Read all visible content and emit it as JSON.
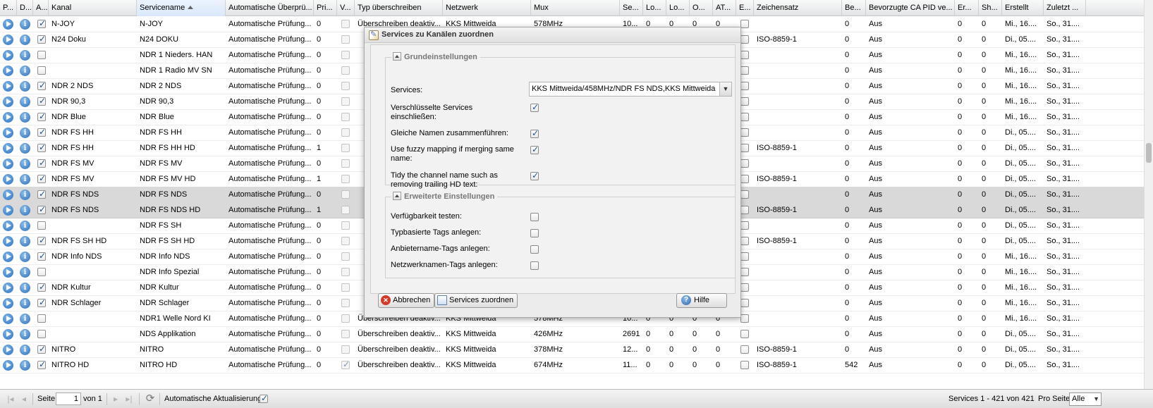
{
  "columns": [
    {
      "label": "P...",
      "w": 24
    },
    {
      "label": "D...",
      "w": 23
    },
    {
      "label": "A...",
      "w": 22
    },
    {
      "label": "Kanal",
      "w": 125
    },
    {
      "label": "Servicename",
      "w": 126,
      "sorted": true
    },
    {
      "label": "Automatische Überprü...",
      "w": 125
    },
    {
      "label": "Pri...",
      "w": 33
    },
    {
      "label": "V...",
      "w": 25
    },
    {
      "label": "Typ überschreiben",
      "w": 125
    },
    {
      "label": "Netzwerk",
      "w": 125
    },
    {
      "label": "Mux",
      "w": 126
    },
    {
      "label": "Se...",
      "w": 33
    },
    {
      "label": "Lo...",
      "w": 33
    },
    {
      "label": "Lo...",
      "w": 33
    },
    {
      "label": "O...",
      "w": 33
    },
    {
      "label": "AT...",
      "w": 33
    },
    {
      "label": "E...",
      "w": 25
    },
    {
      "label": "Zeichensatz",
      "w": 125
    },
    {
      "label": "Be...",
      "w": 34
    },
    {
      "label": "Bevorzugte CA PID ve...",
      "w": 126
    },
    {
      "label": "Er...",
      "w": 34
    },
    {
      "label": "Sh...",
      "w": 33
    },
    {
      "label": "Erstellt",
      "w": 59
    },
    {
      "label": "Zuletzt ...",
      "w": 60
    }
  ],
  "rows": [
    {
      "a": true,
      "kanal": "N-JOY",
      "svc": "N-JOY",
      "auto": "Automatische Prüfung...",
      "pri": "0",
      "v": false,
      "typ": "Überschreiben deaktiv...",
      "net": "KKS Mittweida",
      "mux": "578MHz",
      "se": "10...",
      "lo1": "0",
      "lo2": "0",
      "o": "0",
      "at": "0",
      "zs": "",
      "be": "0",
      "ca": "Aus",
      "er": "0",
      "sh": "0",
      "erst": "Mi., 16....",
      "zul": "So., 31...."
    },
    {
      "a": true,
      "kanal": "N24 Doku",
      "svc": "N24 DOKU",
      "auto": "Automatische Prüfung...",
      "pri": "0",
      "v": false,
      "typ": "",
      "net": "",
      "mux": "",
      "se": "",
      "lo1": "",
      "lo2": "",
      "o": "",
      "at": "",
      "zs": "ISO-8859-1",
      "be": "0",
      "ca": "Aus",
      "er": "0",
      "sh": "0",
      "erst": "Di., 05....",
      "zul": "So., 31...."
    },
    {
      "a": false,
      "kanal": "",
      "svc": "NDR 1 Nieders. HAN",
      "auto": "Automatische Prüfung...",
      "pri": "0",
      "v": false,
      "typ": "",
      "net": "",
      "mux": "",
      "se": "",
      "lo1": "",
      "lo2": "",
      "o": "",
      "at": "",
      "zs": "",
      "be": "0",
      "ca": "Aus",
      "er": "0",
      "sh": "0",
      "erst": "Mi., 16....",
      "zul": "So., 31...."
    },
    {
      "a": false,
      "kanal": "",
      "svc": "NDR 1 Radio MV SN",
      "auto": "Automatische Prüfung...",
      "pri": "0",
      "v": false,
      "typ": "",
      "net": "",
      "mux": "",
      "se": "",
      "lo1": "",
      "lo2": "",
      "o": "",
      "at": "",
      "zs": "",
      "be": "0",
      "ca": "Aus",
      "er": "0",
      "sh": "0",
      "erst": "Mi., 16....",
      "zul": "So., 31...."
    },
    {
      "a": true,
      "kanal": "NDR 2 NDS",
      "svc": "NDR 2 NDS",
      "auto": "Automatische Prüfung...",
      "pri": "0",
      "v": false,
      "typ": "",
      "net": "",
      "mux": "",
      "se": "",
      "lo1": "",
      "lo2": "",
      "o": "",
      "at": "",
      "zs": "",
      "be": "0",
      "ca": "Aus",
      "er": "0",
      "sh": "0",
      "erst": "Mi., 16....",
      "zul": "So., 31...."
    },
    {
      "a": true,
      "kanal": "NDR 90,3",
      "svc": "NDR 90,3",
      "auto": "Automatische Prüfung...",
      "pri": "0",
      "v": false,
      "typ": "",
      "net": "",
      "mux": "",
      "se": "",
      "lo1": "",
      "lo2": "",
      "o": "",
      "at": "",
      "zs": "",
      "be": "0",
      "ca": "Aus",
      "er": "0",
      "sh": "0",
      "erst": "Mi., 16....",
      "zul": "So., 31...."
    },
    {
      "a": true,
      "kanal": "NDR Blue",
      "svc": "NDR Blue",
      "auto": "Automatische Prüfung...",
      "pri": "0",
      "v": false,
      "typ": "",
      "net": "",
      "mux": "",
      "se": "",
      "lo1": "",
      "lo2": "",
      "o": "",
      "at": "",
      "zs": "",
      "be": "0",
      "ca": "Aus",
      "er": "0",
      "sh": "0",
      "erst": "Mi., 16....",
      "zul": "So., 31...."
    },
    {
      "a": true,
      "kanal": "NDR FS HH",
      "svc": "NDR FS HH",
      "auto": "Automatische Prüfung...",
      "pri": "0",
      "v": false,
      "typ": "",
      "net": "",
      "mux": "",
      "se": "",
      "lo1": "",
      "lo2": "",
      "o": "",
      "at": "",
      "zs": "",
      "be": "0",
      "ca": "Aus",
      "er": "0",
      "sh": "0",
      "erst": "Di., 05....",
      "zul": "So., 31...."
    },
    {
      "a": true,
      "kanal": "NDR FS HH",
      "svc": "NDR FS HH HD",
      "auto": "Automatische Prüfung...",
      "pri": "1",
      "v": false,
      "typ": "",
      "net": "",
      "mux": "",
      "se": "",
      "lo1": "",
      "lo2": "",
      "o": "",
      "at": "",
      "zs": "ISO-8859-1",
      "be": "0",
      "ca": "Aus",
      "er": "0",
      "sh": "0",
      "erst": "Di., 05....",
      "zul": "So., 31...."
    },
    {
      "a": true,
      "kanal": "NDR FS MV",
      "svc": "NDR FS MV",
      "auto": "Automatische Prüfung...",
      "pri": "0",
      "v": false,
      "typ": "",
      "net": "",
      "mux": "",
      "se": "",
      "lo1": "",
      "lo2": "",
      "o": "",
      "at": "",
      "zs": "",
      "be": "0",
      "ca": "Aus",
      "er": "0",
      "sh": "0",
      "erst": "Di., 05....",
      "zul": "So., 31...."
    },
    {
      "a": true,
      "kanal": "NDR FS MV",
      "svc": "NDR FS MV HD",
      "auto": "Automatische Prüfung...",
      "pri": "1",
      "v": false,
      "typ": "",
      "net": "",
      "mux": "",
      "se": "",
      "lo1": "",
      "lo2": "",
      "o": "",
      "at": "",
      "zs": "ISO-8859-1",
      "be": "0",
      "ca": "Aus",
      "er": "0",
      "sh": "0",
      "erst": "Di., 05....",
      "zul": "So., 31...."
    },
    {
      "a": true,
      "kanal": "NDR FS NDS",
      "svc": "NDR FS NDS",
      "auto": "Automatische Prüfung...",
      "pri": "0",
      "v": false,
      "typ": "",
      "net": "",
      "mux": "",
      "se": "",
      "lo1": "",
      "lo2": "",
      "o": "",
      "at": "",
      "zs": "",
      "be": "0",
      "ca": "Aus",
      "er": "0",
      "sh": "0",
      "erst": "Di., 05....",
      "zul": "So., 31....",
      "selected": true
    },
    {
      "a": true,
      "kanal": "NDR FS NDS",
      "svc": "NDR FS NDS HD",
      "auto": "Automatische Prüfung...",
      "pri": "1",
      "v": false,
      "typ": "",
      "net": "",
      "mux": "",
      "se": "",
      "lo1": "",
      "lo2": "",
      "o": "",
      "at": "",
      "zs": "ISO-8859-1",
      "be": "0",
      "ca": "Aus",
      "er": "0",
      "sh": "0",
      "erst": "Di., 05....",
      "zul": "So., 31....",
      "selected": true
    },
    {
      "a": false,
      "kanal": "",
      "svc": "NDR FS SH",
      "auto": "Automatische Prüfung...",
      "pri": "0",
      "v": false,
      "typ": "",
      "net": "",
      "mux": "",
      "se": "",
      "lo1": "",
      "lo2": "",
      "o": "",
      "at": "",
      "zs": "",
      "be": "0",
      "ca": "Aus",
      "er": "0",
      "sh": "0",
      "erst": "Di., 05....",
      "zul": "So., 31...."
    },
    {
      "a": true,
      "kanal": "NDR FS SH HD",
      "svc": "NDR FS SH HD",
      "auto": "Automatische Prüfung...",
      "pri": "0",
      "v": false,
      "typ": "",
      "net": "",
      "mux": "",
      "se": "",
      "lo1": "",
      "lo2": "",
      "o": "",
      "at": "",
      "zs": "ISO-8859-1",
      "be": "0",
      "ca": "Aus",
      "er": "0",
      "sh": "0",
      "erst": "Di., 05....",
      "zul": "So., 31...."
    },
    {
      "a": true,
      "kanal": "NDR Info NDS",
      "svc": "NDR Info NDS",
      "auto": "Automatische Prüfung...",
      "pri": "0",
      "v": false,
      "typ": "",
      "net": "",
      "mux": "",
      "se": "",
      "lo1": "",
      "lo2": "",
      "o": "",
      "at": "",
      "zs": "",
      "be": "0",
      "ca": "Aus",
      "er": "0",
      "sh": "0",
      "erst": "Mi., 16....",
      "zul": "So., 31...."
    },
    {
      "a": false,
      "kanal": "",
      "svc": "NDR Info Spezial",
      "auto": "Automatische Prüfung...",
      "pri": "0",
      "v": false,
      "typ": "",
      "net": "",
      "mux": "",
      "se": "",
      "lo1": "",
      "lo2": "",
      "o": "",
      "at": "",
      "zs": "",
      "be": "0",
      "ca": "Aus",
      "er": "0",
      "sh": "0",
      "erst": "Mi., 16....",
      "zul": "So., 31...."
    },
    {
      "a": true,
      "kanal": "NDR Kultur",
      "svc": "NDR Kultur",
      "auto": "Automatische Prüfung...",
      "pri": "0",
      "v": false,
      "typ": "",
      "net": "",
      "mux": "",
      "se": "",
      "lo1": "",
      "lo2": "",
      "o": "",
      "at": "",
      "zs": "",
      "be": "0",
      "ca": "Aus",
      "er": "0",
      "sh": "0",
      "erst": "Mi., 16....",
      "zul": "So., 31...."
    },
    {
      "a": true,
      "kanal": "NDR Schlager",
      "svc": "NDR Schlager",
      "auto": "Automatische Prüfung...",
      "pri": "0",
      "v": false,
      "typ": "",
      "net": "",
      "mux": "",
      "se": "",
      "lo1": "",
      "lo2": "",
      "o": "",
      "at": "",
      "zs": "",
      "be": "0",
      "ca": "Aus",
      "er": "0",
      "sh": "0",
      "erst": "Mi., 16....",
      "zul": "So., 31...."
    },
    {
      "a": false,
      "kanal": "",
      "svc": "NDR1 Welle Nord KI",
      "auto": "Automatische Prüfung...",
      "pri": "0",
      "v": false,
      "typ": "Überschreiben deaktiv...",
      "net": "KKS Mittweida",
      "mux": "578MHz",
      "se": "10...",
      "lo1": "0",
      "lo2": "0",
      "o": "0",
      "at": "0",
      "zs": "",
      "be": "0",
      "ca": "Aus",
      "er": "0",
      "sh": "0",
      "erst": "Mi., 16....",
      "zul": "So., 31...."
    },
    {
      "a": false,
      "kanal": "",
      "svc": "NDS Applikation",
      "auto": "Automatische Prüfung...",
      "pri": "0",
      "v": false,
      "typ": "Überschreiben deaktiv...",
      "net": "KKS Mittweida",
      "mux": "426MHz",
      "se": "2691",
      "lo1": "0",
      "lo2": "0",
      "o": "0",
      "at": "0",
      "zs": "",
      "be": "0",
      "ca": "Aus",
      "er": "0",
      "sh": "0",
      "erst": "Di., 05....",
      "zul": "So., 31...."
    },
    {
      "a": true,
      "kanal": "NITRO",
      "svc": "NITRO",
      "auto": "Automatische Prüfung...",
      "pri": "0",
      "v": false,
      "typ": "Überschreiben deaktiv...",
      "net": "KKS Mittweida",
      "mux": "378MHz",
      "se": "12...",
      "lo1": "0",
      "lo2": "0",
      "o": "0",
      "at": "0",
      "zs": "ISO-8859-1",
      "be": "0",
      "ca": "Aus",
      "er": "0",
      "sh": "0",
      "erst": "Di., 05....",
      "zul": "So., 31...."
    },
    {
      "a": true,
      "kanal": "NITRO HD",
      "svc": "NITRO HD",
      "auto": "Automatische Prüfung...",
      "pri": "0",
      "v": true,
      "typ": "Überschreiben deaktiv...",
      "net": "KKS Mittweida",
      "mux": "674MHz",
      "se": "11...",
      "lo1": "0",
      "lo2": "0",
      "o": "0",
      "at": "0",
      "zs": "ISO-8859-1",
      "be": "542",
      "ca": "Aus",
      "er": "0",
      "sh": "0",
      "erst": "Di., 05....",
      "zul": "So., 31...."
    }
  ],
  "pager": {
    "page_label": "Seite",
    "page_value": "1",
    "of_label": "von 1",
    "auto_refresh_label": "Automatische Aktualisierung",
    "auto_refresh": true,
    "summary": "Services 1 - 421 von 421",
    "per_page_label": "Pro Seite",
    "per_page_value": "Alle"
  },
  "dialog": {
    "title": "Services zu Kanälen zuordnen",
    "basic_legend": "Grundeinstellungen",
    "services_label": "Services:",
    "services_value": "KKS Mittweida/458MHz/NDR FS NDS,KKS Mittweida",
    "encrypted_label": "Verschlüsselte Services einschließen:",
    "merge_label": "Gleiche Namen zusammenführen:",
    "fuzzy_label": "Use fuzzy mapping if merging same name:",
    "tidy_label": "Tidy the channel name such as removing trailing HD text:",
    "adv_legend": "Erweiterte Einstellungen",
    "check_avail_label": "Verfügbarkeit testen:",
    "type_tags_label": "Typbasierte Tags anlegen:",
    "provider_tags_label": "Anbietername-Tags anlegen:",
    "network_tags_label": "Netzwerknamen-Tags anlegen:",
    "cancel_label": "Abbrechen",
    "assign_label": "Services zuordnen",
    "help_label": "Hilfe",
    "checks": {
      "encrypted": true,
      "merge": true,
      "fuzzy": true,
      "tidy": true,
      "check_avail": false,
      "type_tags": false,
      "provider_tags": false,
      "network_tags": false
    }
  }
}
